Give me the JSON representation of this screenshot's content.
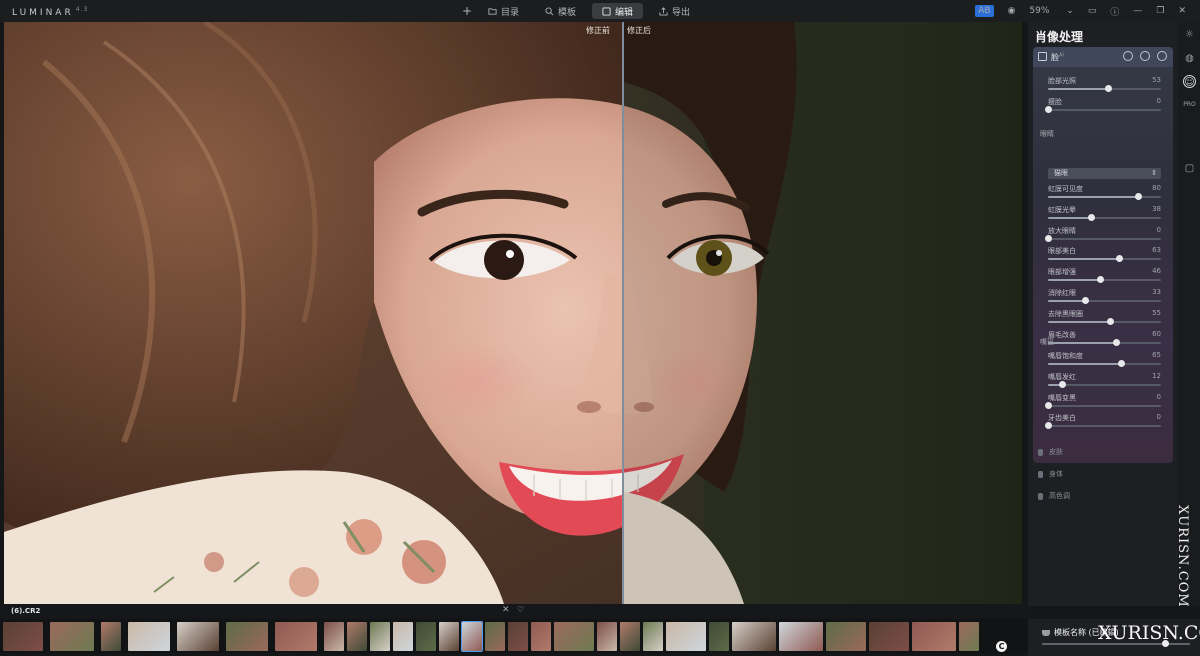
{
  "app": {
    "logo": "LUMINAR",
    "version": "4.3"
  },
  "toolbar": {
    "add_label": "+",
    "tabs": [
      {
        "label": "目录",
        "icon": "folder-icon"
      },
      {
        "label": "模板",
        "icon": "search-icon"
      },
      {
        "label": "编辑",
        "icon": "edit-icon",
        "active": true
      },
      {
        "label": "导出",
        "icon": "share-icon"
      }
    ],
    "compare_badge": "AB",
    "zoom": "59%",
    "accent": "#2b6fd8"
  },
  "canvas": {
    "before_label": "修正前",
    "after_label": "修正后"
  },
  "panel": {
    "title": "肖像处理",
    "module": {
      "label": "脸",
      "icon": "portrait-icon",
      "ai_mark": "AI"
    },
    "face_sliders": [
      {
        "name": "脸部光照",
        "value": 53,
        "pct": 0.53
      },
      {
        "name": "瘦脸",
        "value": 0,
        "pct": 0.0
      }
    ],
    "eyes_section": "眼睛",
    "eye_dropdown": "猫眼",
    "eye_sliders": [
      {
        "name": "虹膜可见度",
        "value": 80,
        "pct": 0.8
      },
      {
        "name": "虹膜光晕",
        "value": 38,
        "pct": 0.38
      },
      {
        "name": "放大眼睛",
        "value": 0,
        "pct": 0.0
      },
      {
        "name": "眼部美白",
        "value": 63,
        "pct": 0.63
      },
      {
        "name": "眼部增强",
        "value": 46,
        "pct": 0.46
      },
      {
        "name": "消除红眼",
        "value": 33,
        "pct": 0.33
      },
      {
        "name": "去除黑眼圈",
        "value": 55,
        "pct": 0.55
      },
      {
        "name": "眉毛改善",
        "value": 60,
        "pct": 0.6
      }
    ],
    "mouth_section": "嘴巴",
    "mouth_sliders": [
      {
        "name": "嘴唇饱和度",
        "value": 65,
        "pct": 0.65
      },
      {
        "name": "嘴唇发红",
        "value": 12,
        "pct": 0.12
      },
      {
        "name": "嘴唇变黑",
        "value": 0,
        "pct": 0.0
      },
      {
        "name": "牙齿美白",
        "value": 0,
        "pct": 0.0
      }
    ],
    "collapsed": [
      {
        "label": "皮肤",
        "icon": "skin-icon"
      },
      {
        "label": "身体",
        "icon": "body-icon"
      },
      {
        "label": "高色调",
        "icon": "highkey-icon"
      }
    ]
  },
  "sidetools": {
    "items": [
      {
        "icon": "sun-icon",
        "glyph": "☼"
      },
      {
        "icon": "palette-icon",
        "glyph": "◍"
      },
      {
        "icon": "face-icon",
        "glyph": "☺"
      },
      {
        "icon": "pro-icon",
        "glyph": "PRO"
      },
      {
        "icon": "history-icon",
        "glyph": "▢"
      }
    ]
  },
  "filmstrip": {
    "filename": "(6).CR2",
    "close_glyph": "✕",
    "heart_glyph": "♡"
  },
  "bottom": {
    "amount_label": "模板名称 (已编辑)"
  },
  "watermark": {
    "vertical": "XURISN.COM",
    "horizontal": "XURISN.COM"
  },
  "c_badge": "C"
}
